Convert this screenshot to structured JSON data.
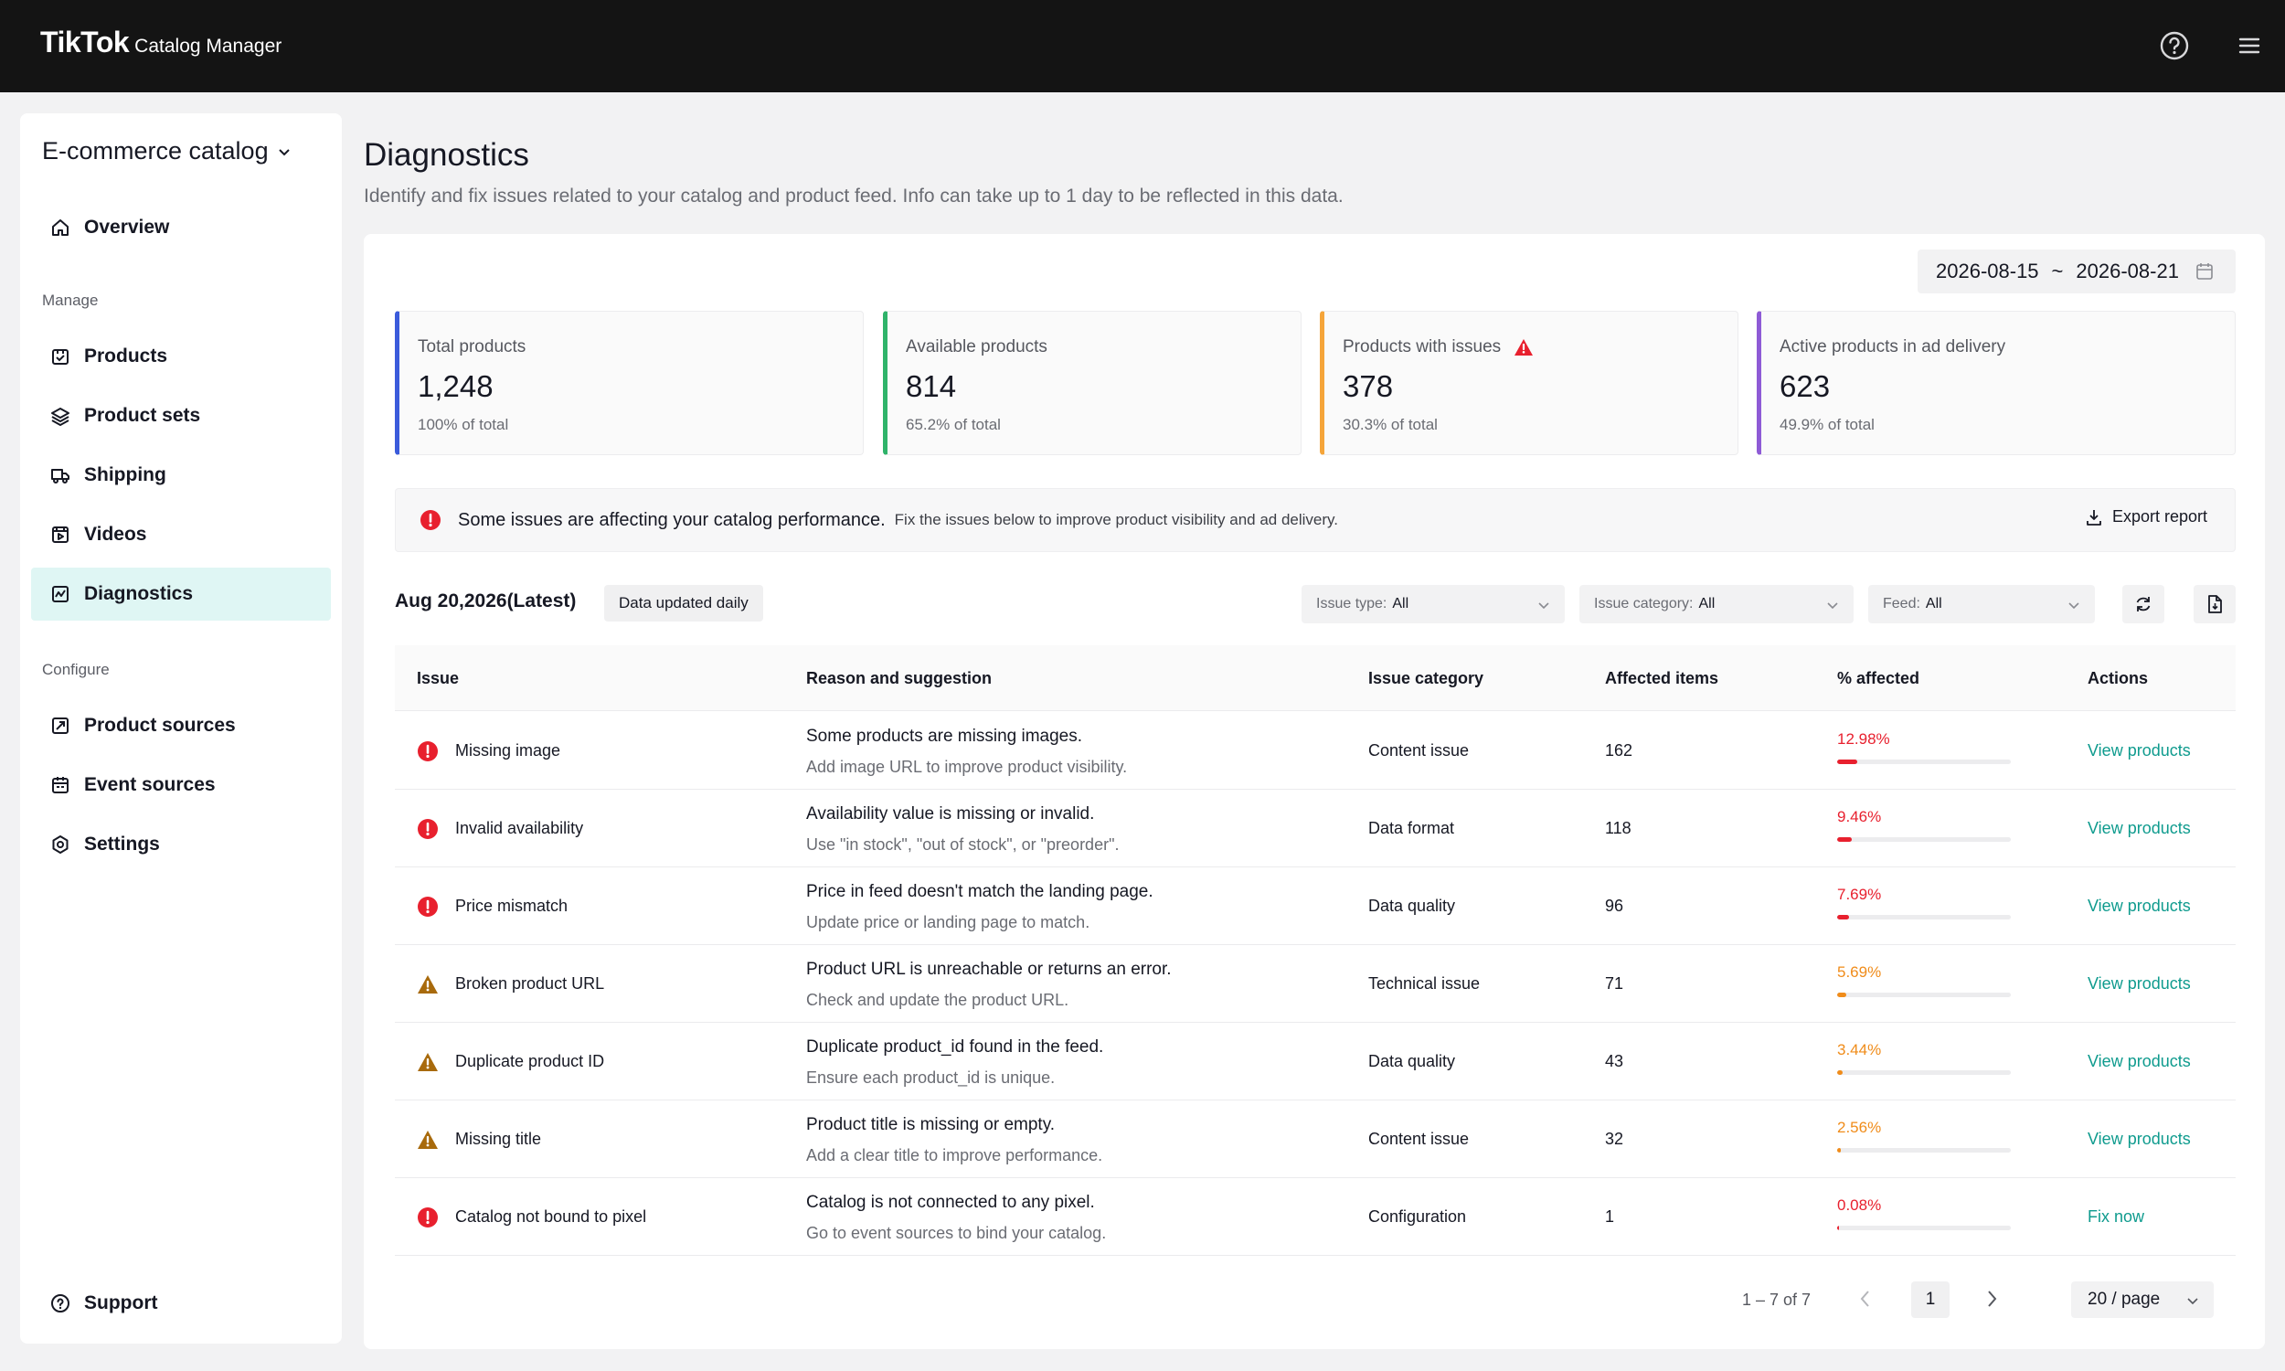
{
  "header": {
    "brand": "TikTok",
    "product": "Catalog Manager",
    "icons": [
      "help-icon",
      "menu-icon"
    ]
  },
  "sidebar": {
    "catalog_name": "E-commerce catalog",
    "overview": "Overview",
    "section_manage": "Manage",
    "manage_items": [
      "Products",
      "Product sets",
      "Shipping",
      "Videos",
      "Diagnostics"
    ],
    "section_configure": "Configure",
    "configure_items": [
      "Product sources",
      "Event sources",
      "Settings"
    ],
    "support": "Support",
    "active_item": "Diagnostics"
  },
  "page": {
    "title": "Diagnostics",
    "description": "Identify and fix issues related to your catalog and product feed. Info can take up to 1 day to be reflected in this data."
  },
  "date_range": {
    "start": "2026-08-15",
    "separator": "~",
    "end": "2026-08-21"
  },
  "metrics": [
    {
      "label": "Total products",
      "value": "1,248",
      "sub": "100% of total",
      "accent": "#3b5bdb"
    },
    {
      "label": "Available products",
      "value": "814",
      "sub": "65.2% of total",
      "accent": "#2fb36a"
    },
    {
      "label": "Products with issues",
      "value": "378",
      "sub": "30.3% of total",
      "accent": "#f5a53a",
      "warning": true
    },
    {
      "label": "Active products in ad delivery",
      "value": "623",
      "sub": "49.9% of total",
      "accent": "#8e5bd6"
    }
  ],
  "alert": {
    "strong": "Some issues are affecting your catalog performance.",
    "text": "Fix the issues below to improve product visibility and ad delivery.",
    "export_label": "Export report"
  },
  "toolbar": {
    "latest": "Aug 20,2026(Latest)",
    "updated_badge": "Data updated daily",
    "filters": [
      {
        "label": "Issue type:",
        "value": "All"
      },
      {
        "label": "Issue category:",
        "value": "All"
      },
      {
        "label": "Feed:",
        "value": "All"
      }
    ]
  },
  "table": {
    "columns": [
      "Issue",
      "Reason and suggestion",
      "Issue category",
      "Affected items",
      "% affected",
      "Actions"
    ],
    "rows": [
      {
        "severity": "error",
        "issue": "Missing image",
        "reason": "Some products are missing images.",
        "suggestion": "Add image URL to improve product visibility.",
        "category": "Content issue",
        "affected": "162",
        "pct_text": "12.98%",
        "pct": 12.98,
        "action": "View products"
      },
      {
        "severity": "error",
        "issue": "Invalid availability",
        "reason": "Availability value is missing or invalid.",
        "suggestion": "Use \"in stock\", \"out of stock\", or \"preorder\".",
        "category": "Data format",
        "affected": "118",
        "pct_text": "9.46%",
        "pct": 9.46,
        "action": "View products"
      },
      {
        "severity": "error",
        "issue": "Price mismatch",
        "reason": "Price in feed doesn't match the landing page.",
        "suggestion": "Update price or landing page to match.",
        "category": "Data quality",
        "affected": "96",
        "pct_text": "7.69%",
        "pct": 7.69,
        "action": "View products"
      },
      {
        "severity": "warning",
        "issue": "Broken product URL",
        "reason": "Product URL is unreachable or returns an error.",
        "suggestion": "Check and update the product URL.",
        "category": "Technical issue",
        "affected": "71",
        "pct_text": "5.69%",
        "pct": 5.69,
        "action": "View products"
      },
      {
        "severity": "warning",
        "issue": "Duplicate product ID",
        "reason": "Duplicate product_id found in the feed.",
        "suggestion": "Ensure each product_id is unique.",
        "category": "Data quality",
        "affected": "43",
        "pct_text": "3.44%",
        "pct": 3.44,
        "action": "View products"
      },
      {
        "severity": "warning",
        "issue": "Missing title",
        "reason": "Product title is missing or empty.",
        "suggestion": "Add a clear title to improve performance.",
        "category": "Content issue",
        "affected": "32",
        "pct_text": "2.56%",
        "pct": 2.56,
        "action": "View products"
      },
      {
        "severity": "error",
        "issue": "Catalog not bound to pixel",
        "reason": "Catalog is not connected to any pixel.",
        "suggestion": "Go to event sources to bind your catalog.",
        "category": "Configuration",
        "affected": "1",
        "pct_text": "0.08%",
        "pct": 0.08,
        "action": "Fix now"
      }
    ]
  },
  "pagination": {
    "count": "1 – 7 of 7",
    "current_page": "1",
    "page_size": "20 / page"
  },
  "colors": {
    "error": "#e8202e",
    "warning": "#f08c1a",
    "warning_icon": "#a86a0c",
    "link": "#0f9b8e",
    "active_nav": "#dff6f4"
  }
}
